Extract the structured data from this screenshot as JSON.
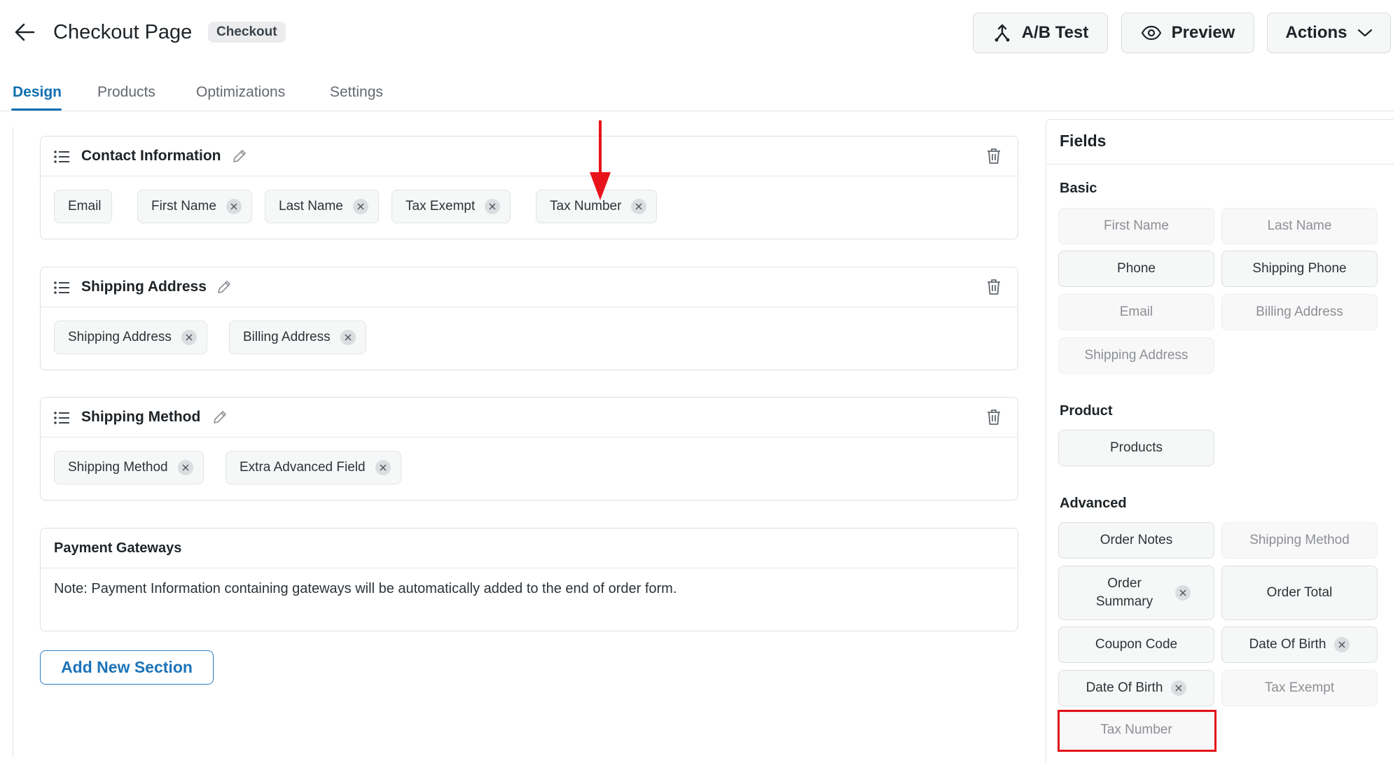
{
  "header": {
    "title": "Checkout Page",
    "badge": "Checkout",
    "buttons": {
      "ab_test": "A/B Test",
      "preview": "Preview",
      "actions": "Actions"
    }
  },
  "tabs": [
    "Design",
    "Products",
    "Optimizations",
    "Settings"
  ],
  "active_tab": "Design",
  "sections": [
    {
      "title": "Contact Information",
      "fields": [
        "Email",
        "First Name",
        "Last Name",
        "Tax Exempt",
        "Tax Number"
      ]
    },
    {
      "title": "Shipping Address",
      "fields": [
        "Shipping Address",
        "Billing Address"
      ]
    },
    {
      "title": "Shipping Method",
      "fields": [
        "Shipping Method",
        "Extra Advanced Field"
      ]
    }
  ],
  "payment": {
    "title": "Payment Gateways",
    "note": "Note: Payment Information containing gateways will be automatically added to the end of order form."
  },
  "add_section_label": "Add New Section",
  "fields_panel": {
    "title": "Fields",
    "groups": [
      {
        "title": "Basic",
        "items": [
          {
            "label": "First Name",
            "state": "disabled"
          },
          {
            "label": "Last Name",
            "state": "disabled"
          },
          {
            "label": "Phone",
            "state": "available"
          },
          {
            "label": "Shipping Phone",
            "state": "available"
          },
          {
            "label": "Email",
            "state": "disabled"
          },
          {
            "label": "Billing Address",
            "state": "disabled"
          },
          {
            "label": "Shipping Address",
            "state": "disabled"
          }
        ]
      },
      {
        "title": "Product",
        "items": [
          {
            "label": "Products",
            "state": "available"
          }
        ]
      },
      {
        "title": "Advanced",
        "items": [
          {
            "label": "Order Notes",
            "state": "available"
          },
          {
            "label": "Shipping Method",
            "state": "disabled"
          },
          {
            "label": "Order Summary",
            "state": "available",
            "removable": true
          },
          {
            "label": "Order Total",
            "state": "available"
          },
          {
            "label": "Coupon Code",
            "state": "available"
          },
          {
            "label": "Date Of Birth",
            "state": "available",
            "removable": true
          },
          {
            "label": "Date Of Birth",
            "state": "available",
            "removable": true
          },
          {
            "label": "Tax Exempt",
            "state": "disabled"
          },
          {
            "label": "Tax Number",
            "state": "disabled",
            "highlighted": true
          }
        ]
      }
    ]
  },
  "colors": {
    "accent": "#0e6fb0",
    "highlight": "#e2121a",
    "arrow": "#e8121a"
  }
}
